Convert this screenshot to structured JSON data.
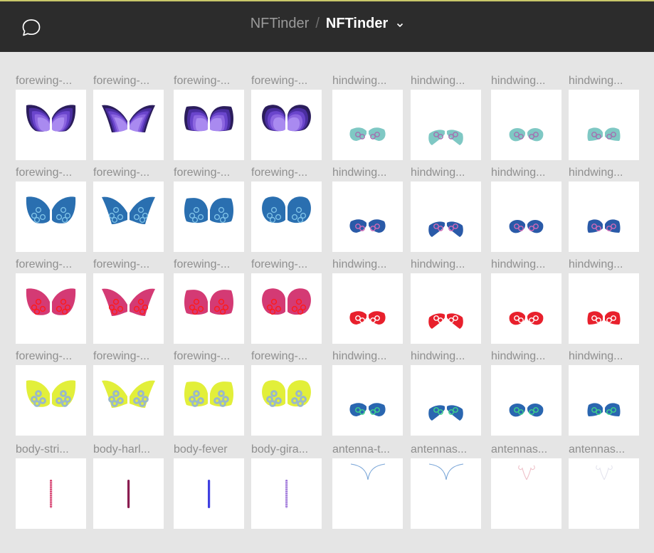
{
  "header": {
    "parent": "NFTinder",
    "separator": "/",
    "current": "NFTinder"
  },
  "icons": {
    "comment": "comment-icon",
    "chevron": "chevron-down-icon"
  },
  "rows": [
    {
      "items": [
        {
          "label": "forewing-...",
          "kind": "forewing-round",
          "theme": "purple"
        },
        {
          "label": "forewing-...",
          "kind": "forewing-pointed",
          "theme": "purple"
        },
        {
          "label": "forewing-...",
          "kind": "forewing-square",
          "theme": "purple"
        },
        {
          "label": "forewing-...",
          "kind": "forewing-circle",
          "theme": "purple"
        },
        {
          "label": "hindwing...",
          "kind": "hindwing-round",
          "theme": "teal"
        },
        {
          "label": "hindwing...",
          "kind": "hindwing-pointed",
          "theme": "teal"
        },
        {
          "label": "hindwing...",
          "kind": "hindwing-circle",
          "theme": "teal"
        },
        {
          "label": "hindwing...",
          "kind": "hindwing-square",
          "theme": "teal"
        }
      ]
    },
    {
      "items": [
        {
          "label": "forewing-...",
          "kind": "forewing-round",
          "theme": "blue"
        },
        {
          "label": "forewing-...",
          "kind": "forewing-pointed",
          "theme": "blue"
        },
        {
          "label": "forewing-...",
          "kind": "forewing-square",
          "theme": "blue"
        },
        {
          "label": "forewing-...",
          "kind": "forewing-circle",
          "theme": "blue"
        },
        {
          "label": "hindwing...",
          "kind": "hindwing-round",
          "theme": "navy"
        },
        {
          "label": "hindwing...",
          "kind": "hindwing-pointed",
          "theme": "navy"
        },
        {
          "label": "hindwing...",
          "kind": "hindwing-circle",
          "theme": "navy"
        },
        {
          "label": "hindwing...",
          "kind": "hindwing-square",
          "theme": "navy"
        }
      ]
    },
    {
      "items": [
        {
          "label": "forewing-...",
          "kind": "forewing-round",
          "theme": "magenta"
        },
        {
          "label": "forewing-...",
          "kind": "forewing-pointed",
          "theme": "magenta"
        },
        {
          "label": "forewing-...",
          "kind": "forewing-square",
          "theme": "magenta"
        },
        {
          "label": "forewing-...",
          "kind": "forewing-circle",
          "theme": "magenta"
        },
        {
          "label": "hindwing...",
          "kind": "hindwing-round",
          "theme": "red"
        },
        {
          "label": "hindwing...",
          "kind": "hindwing-pointed",
          "theme": "red"
        },
        {
          "label": "hindwing...",
          "kind": "hindwing-circle",
          "theme": "red"
        },
        {
          "label": "hindwing...",
          "kind": "hindwing-square",
          "theme": "red"
        }
      ]
    },
    {
      "items": [
        {
          "label": "forewing-...",
          "kind": "forewing-round",
          "theme": "lime"
        },
        {
          "label": "forewing-...",
          "kind": "forewing-pointed",
          "theme": "lime"
        },
        {
          "label": "forewing-...",
          "kind": "forewing-square",
          "theme": "lime"
        },
        {
          "label": "forewing-...",
          "kind": "forewing-circle",
          "theme": "lime"
        },
        {
          "label": "hindwing...",
          "kind": "hindwing-round",
          "theme": "peacock"
        },
        {
          "label": "hindwing...",
          "kind": "hindwing-pointed",
          "theme": "peacock"
        },
        {
          "label": "hindwing...",
          "kind": "hindwing-circle",
          "theme": "peacock"
        },
        {
          "label": "hindwing...",
          "kind": "hindwing-square",
          "theme": "peacock"
        }
      ]
    },
    {
      "items": [
        {
          "label": "body-stri...",
          "kind": "body",
          "theme": "body-striped"
        },
        {
          "label": "body-harl...",
          "kind": "body",
          "theme": "body-harlequin"
        },
        {
          "label": "body-fever",
          "kind": "body",
          "theme": "body-fever"
        },
        {
          "label": "body-gira...",
          "kind": "body",
          "theme": "body-giraffe"
        },
        {
          "label": "antenna-t...",
          "kind": "antenna-thin",
          "theme": "antenna-blue"
        },
        {
          "label": "antennas...",
          "kind": "antenna-thin",
          "theme": "antenna-blue"
        },
        {
          "label": "antennas...",
          "kind": "antenna-curl",
          "theme": "antenna-pink"
        },
        {
          "label": "antennas...",
          "kind": "antenna-curl",
          "theme": "antenna-faint"
        }
      ]
    }
  ],
  "colors": {
    "topbar": "#2c2c2c",
    "canvas": "#e5e5e5",
    "purple": [
      "#2b1d5c",
      "#4a2ea0",
      "#6a45cc",
      "#8c66e0",
      "#a98af0"
    ],
    "teal": [
      "#7fc8c4",
      "#a46fb0"
    ],
    "blue": [
      "#2a6fb0",
      "#7cc0e6"
    ],
    "navy": [
      "#2a5aa8",
      "#d06ab6"
    ],
    "magenta": [
      "#d43a74",
      "#ff1a1a",
      "#b090e0"
    ],
    "red": [
      "#e8202c",
      "#ffffff"
    ],
    "lime": [
      "#e2ef3a",
      "#9ab8c8"
    ],
    "peacock": [
      "#2a66b0",
      "#3fd48a"
    ],
    "body-striped": "#d43a6a",
    "body-harlequin": "#8a1d50",
    "body-fever": "#4040e0",
    "body-giraffe": "#9b72d8",
    "antenna-blue": "#7aa6d8",
    "antenna-pink": "#eec0c8",
    "antenna-faint": "#e4e4ee"
  }
}
